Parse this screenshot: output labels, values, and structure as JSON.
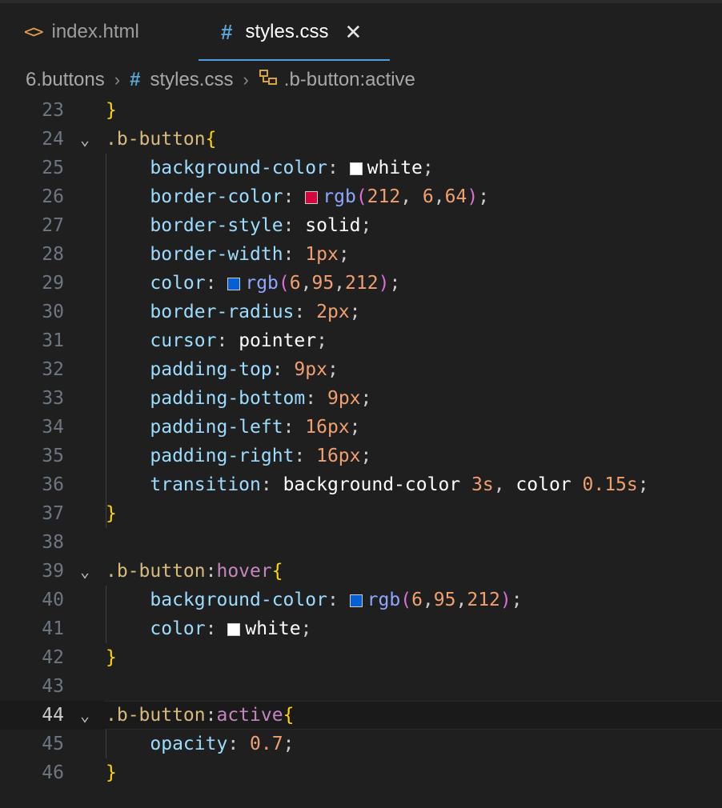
{
  "tabs": [
    {
      "label": "index.html",
      "icon": "html-file-icon",
      "active": false
    },
    {
      "label": "styles.css",
      "icon": "css-hash-icon",
      "active": true
    }
  ],
  "breadcrumb": {
    "folder": "6.buttons",
    "file": "styles.css",
    "symbol": ".b-button:active"
  },
  "swatches": {
    "white": "#ffffff",
    "red": "#d40640",
    "blue": "#065fd4"
  },
  "code": {
    "l23": {
      "no": "23",
      "brace": "}"
    },
    "l24": {
      "no": "24",
      "sel": ".b-button",
      "brace": "{"
    },
    "l25": {
      "no": "25",
      "prop": "background-color",
      "val": "white"
    },
    "l26": {
      "no": "26",
      "prop": "border-color",
      "func": "rgb",
      "args": [
        "212",
        "6",
        "64"
      ]
    },
    "l27": {
      "no": "27",
      "prop": "border-style",
      "val": "solid"
    },
    "l28": {
      "no": "28",
      "prop": "border-width",
      "val": "1px"
    },
    "l29": {
      "no": "29",
      "prop": "color",
      "func": "rgb",
      "args": [
        "6",
        "95",
        "212"
      ]
    },
    "l30": {
      "no": "30",
      "prop": "border-radius",
      "val": "2px"
    },
    "l31": {
      "no": "31",
      "prop": "cursor",
      "val": "pointer"
    },
    "l32": {
      "no": "32",
      "prop": "padding-top",
      "val": "9px"
    },
    "l33": {
      "no": "33",
      "prop": "padding-bottom",
      "val": "9px"
    },
    "l34": {
      "no": "34",
      "prop": "padding-left",
      "val": "16px"
    },
    "l35": {
      "no": "35",
      "prop": "padding-right",
      "val": "16px"
    },
    "l36": {
      "no": "36",
      "prop": "transition",
      "v1": "background-color",
      "n1": "3s",
      "v2": "color",
      "n2": "0.15s"
    },
    "l37": {
      "no": "37",
      "brace": "}"
    },
    "l38": {
      "no": "38"
    },
    "l39": {
      "no": "39",
      "sel": ".b-button",
      "pseudo": "hover",
      "brace": "{"
    },
    "l40": {
      "no": "40",
      "prop": "background-color",
      "func": "rgb",
      "args": [
        "6",
        "95",
        "212"
      ]
    },
    "l41": {
      "no": "41",
      "prop": "color",
      "val": "white"
    },
    "l42": {
      "no": "42",
      "brace": "}"
    },
    "l43": {
      "no": "43"
    },
    "l44": {
      "no": "44",
      "sel": ".b-button",
      "pseudo": "active",
      "brace": "{"
    },
    "l45": {
      "no": "45",
      "prop": "opacity",
      "val": "0.7"
    },
    "l46": {
      "no": "46",
      "brace": "}"
    }
  }
}
